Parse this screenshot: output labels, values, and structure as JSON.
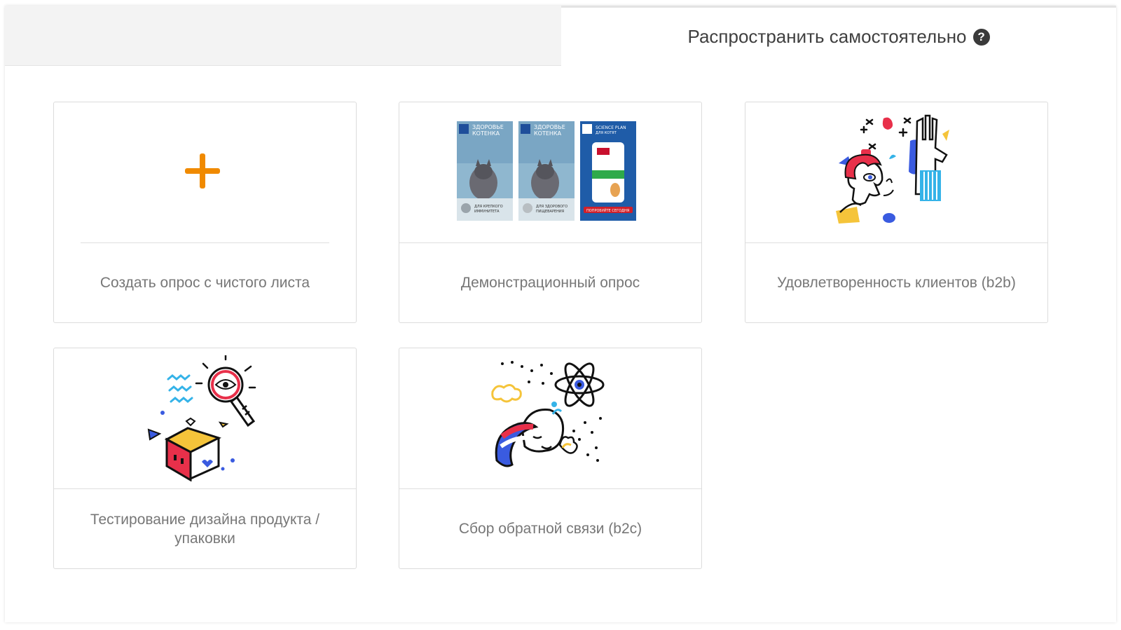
{
  "tabs": {
    "right_title": "Распространить самостоятельно",
    "help_icon": "question-circle-icon"
  },
  "cards": [
    {
      "label": "Создать опрос с чистого листа",
      "icon": "plus-icon",
      "accent": "#f08a00"
    },
    {
      "label": "Демонстрационный опрос",
      "image": "cat-food-ads",
      "posters": [
        {
          "title": "ЗДОРОВЬЕ КОТЕНКА",
          "caption": "ДЛЯ КРЕПКОГО ИММУНИТЕТА"
        },
        {
          "title": "ЗДОРОВЬЕ КОТЕНКА",
          "caption": "ДЛЯ ЗДОРОВОГО ПИЩЕВАРЕНИЯ"
        },
        {
          "title": "SCIENCE PLAN",
          "caption": "ПОПРОБУЙТЕ СЕГОДНЯ"
        }
      ]
    },
    {
      "label": "Удовлетворенность клиентов (b2b)",
      "image": "person-high-five-illustration"
    },
    {
      "label": "Тестирование дизайна продукта / упаковки",
      "image": "magnifier-box-illustration"
    },
    {
      "label": "Сбор обратной связи (b2c)",
      "image": "face-atom-illustration"
    }
  ],
  "colors": {
    "accent": "#f08a00",
    "blue": "#3a5be0",
    "red": "#e8304a",
    "yellow": "#f5c43a",
    "cyan": "#35b3e8"
  }
}
